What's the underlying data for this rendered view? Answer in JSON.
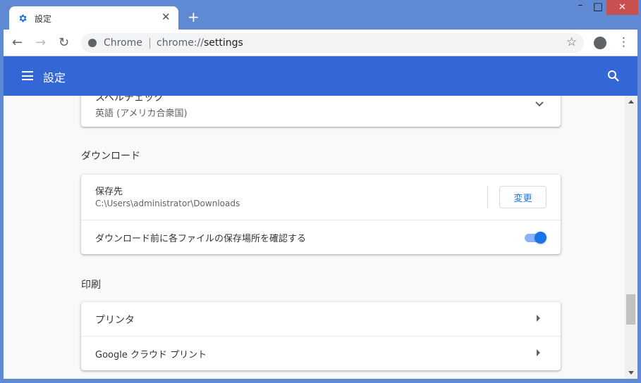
{
  "window": {
    "tab_title": "設定",
    "new_tab": "+",
    "close_tab": "✕",
    "minimize": "–",
    "maximize": "□",
    "close": "✕"
  },
  "toolbar": {
    "back": "←",
    "forward": "→",
    "reload": "↻",
    "site_label": "Chrome",
    "url_prefix": "chrome://",
    "url_path": "settings",
    "star": "☆",
    "menu": "⋮"
  },
  "header": {
    "title": "設定"
  },
  "spellcheck": {
    "title": "スペルチェック",
    "value": "英語 (アメリカ合衆国)"
  },
  "downloads": {
    "heading": "ダウンロード",
    "location_label": "保存先",
    "location_value": "C:\\Users\\administrator\\Downloads",
    "change_button": "変更",
    "ask_label": "ダウンロード前に各ファイルの保存場所を確認する",
    "ask_enabled": true
  },
  "printing": {
    "heading": "印刷",
    "items": [
      {
        "label": "プリンタ"
      },
      {
        "label": "Google クラウド プリント"
      }
    ]
  },
  "colors": {
    "accent": "#3367d6",
    "toggle": "#1a73e8",
    "frame": "#6089d4"
  }
}
